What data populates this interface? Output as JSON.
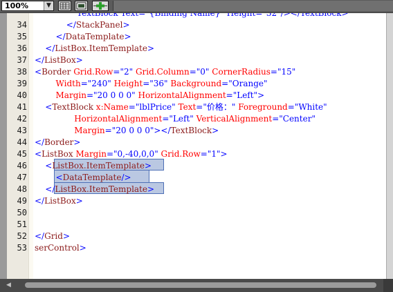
{
  "toolbar": {
    "zoom": "100%",
    "zoom_dropdown": "▼",
    "buttons": [
      "grid-view-icon",
      "image-view-icon",
      "add-element-icon"
    ]
  },
  "colors": {
    "tag": "#8b1a1a",
    "attribute": "#ff0000",
    "value": "#0000ff",
    "delimiter": "#0000ff",
    "selection": "#bac8e2",
    "selection_border": "#4d6fb6"
  },
  "editor": {
    "lines": [
      {
        "num": "",
        "segs": [
          [
            "d",
            "                "
          ],
          [
            "v",
            "TextBlock Text=\"{Binding Name}\" Height=\"32\"/></TextBlock>"
          ]
        ]
      },
      {
        "num": "34",
        "segs": [
          [
            "x",
            "            "
          ],
          [
            "d",
            "</"
          ],
          [
            "t",
            "StackPanel"
          ],
          [
            "d",
            ">"
          ]
        ]
      },
      {
        "num": "35",
        "segs": [
          [
            "x",
            "        "
          ],
          [
            "d",
            "</"
          ],
          [
            "t",
            "DataTemplate"
          ],
          [
            "d",
            ">"
          ]
        ]
      },
      {
        "num": "36",
        "segs": [
          [
            "x",
            "    "
          ],
          [
            "d",
            "</"
          ],
          [
            "t",
            "ListBox.ItemTemplate"
          ],
          [
            "d",
            ">"
          ]
        ]
      },
      {
        "num": "37",
        "segs": [
          [
            "d",
            "</"
          ],
          [
            "t",
            "ListBox"
          ],
          [
            "d",
            ">"
          ]
        ]
      },
      {
        "num": "38",
        "segs": [
          [
            "d",
            "<"
          ],
          [
            "t",
            "Border"
          ],
          [
            "x",
            " "
          ],
          [
            "a",
            "Grid.Row"
          ],
          [
            "d",
            "="
          ],
          [
            "v",
            "\"2\""
          ],
          [
            "x",
            " "
          ],
          [
            "a",
            "Grid.Column"
          ],
          [
            "d",
            "="
          ],
          [
            "v",
            "\"0\""
          ],
          [
            "x",
            " "
          ],
          [
            "a",
            "CornerRadius"
          ],
          [
            "d",
            "="
          ],
          [
            "v",
            "\"15\""
          ]
        ]
      },
      {
        "num": "39",
        "segs": [
          [
            "x",
            "        "
          ],
          [
            "a",
            "Width"
          ],
          [
            "d",
            "="
          ],
          [
            "v",
            "\"240\""
          ],
          [
            "x",
            " "
          ],
          [
            "a",
            "Height"
          ],
          [
            "d",
            "="
          ],
          [
            "v",
            "\"36\""
          ],
          [
            "x",
            " "
          ],
          [
            "a",
            "Background"
          ],
          [
            "d",
            "="
          ],
          [
            "v",
            "\"Orange\""
          ]
        ]
      },
      {
        "num": "40",
        "segs": [
          [
            "x",
            "        "
          ],
          [
            "a",
            "Margin"
          ],
          [
            "d",
            "="
          ],
          [
            "v",
            "\"20 0 0 0\""
          ],
          [
            "x",
            " "
          ],
          [
            "a",
            "HorizontalAlignment"
          ],
          [
            "d",
            "="
          ],
          [
            "v",
            "\"Left\""
          ],
          [
            "d",
            ">"
          ]
        ]
      },
      {
        "num": "41",
        "segs": [
          [
            "x",
            "    "
          ],
          [
            "d",
            "<"
          ],
          [
            "t",
            "TextBlock"
          ],
          [
            "x",
            " "
          ],
          [
            "a",
            "x:Name"
          ],
          [
            "d",
            "="
          ],
          [
            "v",
            "\"lblPrice\""
          ],
          [
            "x",
            " "
          ],
          [
            "a",
            "Text"
          ],
          [
            "d",
            "="
          ],
          [
            "v",
            "\"价格：\""
          ],
          [
            "x",
            " "
          ],
          [
            "a",
            "Foreground"
          ],
          [
            "d",
            "="
          ],
          [
            "v",
            "\"White\""
          ]
        ]
      },
      {
        "num": "42",
        "segs": [
          [
            "x",
            "               "
          ],
          [
            "a",
            "HorizontalAlignment"
          ],
          [
            "d",
            "="
          ],
          [
            "v",
            "\"Left\""
          ],
          [
            "x",
            " "
          ],
          [
            "a",
            "VerticalAlignment"
          ],
          [
            "d",
            "="
          ],
          [
            "v",
            "\"Center\""
          ]
        ]
      },
      {
        "num": "43",
        "segs": [
          [
            "x",
            "               "
          ],
          [
            "a",
            "Margin"
          ],
          [
            "d",
            "="
          ],
          [
            "v",
            "\"20 0 0 0\""
          ],
          [
            "d",
            "></"
          ],
          [
            "t",
            "TextBlock"
          ],
          [
            "d",
            ">"
          ]
        ]
      },
      {
        "num": "44",
        "segs": [
          [
            "d",
            "</"
          ],
          [
            "t",
            "Border"
          ],
          [
            "d",
            ">"
          ]
        ]
      },
      {
        "num": "45",
        "segs": [
          [
            "d",
            "<"
          ],
          [
            "t",
            "ListBox"
          ],
          [
            "x",
            " "
          ],
          [
            "a",
            "Margin"
          ],
          [
            "d",
            "="
          ],
          [
            "v",
            "\"0,-40,0,0\""
          ],
          [
            "x",
            " "
          ],
          [
            "a",
            "Grid.Row"
          ],
          [
            "d",
            "="
          ],
          [
            "v",
            "\"1\""
          ],
          [
            "d",
            ">"
          ]
        ]
      },
      {
        "num": "46",
        "segs": [
          [
            "x",
            "    "
          ],
          [
            "d",
            "<"
          ],
          [
            "t",
            "ListBox.ItemTemplate"
          ],
          [
            "d",
            ">"
          ]
        ]
      },
      {
        "num": "47",
        "segs": [
          [
            "x",
            "        "
          ],
          [
            "d",
            "<"
          ],
          [
            "t",
            "DataTemplate"
          ],
          [
            "d",
            "/>"
          ]
        ]
      },
      {
        "num": "48",
        "segs": [
          [
            "x",
            "    "
          ],
          [
            "d",
            "</"
          ],
          [
            "t",
            "ListBox.ItemTemplate"
          ],
          [
            "d",
            ">"
          ]
        ]
      },
      {
        "num": "49",
        "segs": [
          [
            "d",
            "</"
          ],
          [
            "t",
            "ListBox"
          ],
          [
            "d",
            ">"
          ]
        ]
      },
      {
        "num": "50",
        "segs": []
      },
      {
        "num": "51",
        "segs": []
      },
      {
        "num": "52",
        "segs": [
          [
            "d",
            "</"
          ],
          [
            "t",
            "Grid"
          ],
          [
            "d",
            ">"
          ]
        ]
      },
      {
        "num": "53",
        "segs": [
          [
            "t",
            "serControl"
          ],
          [
            "d",
            ">"
          ]
        ]
      }
    ]
  }
}
